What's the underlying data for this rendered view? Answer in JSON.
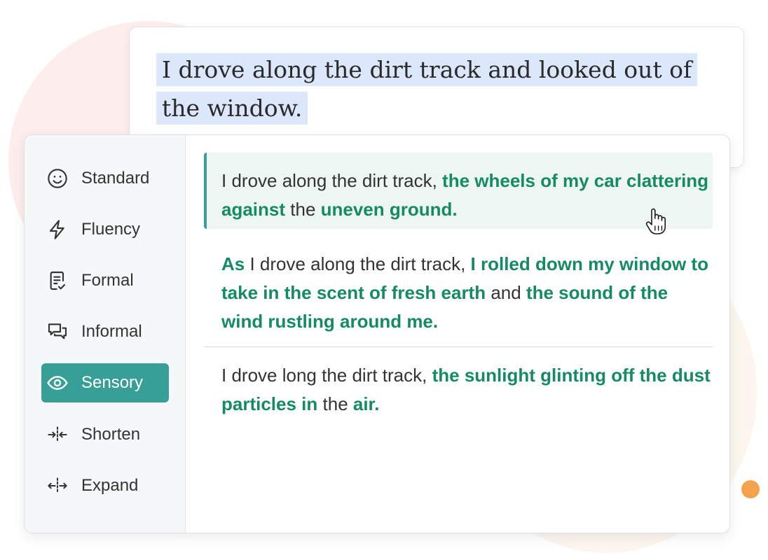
{
  "input": {
    "text": "I drove along the dirt track and looked out of the window."
  },
  "sidebar": {
    "items": [
      {
        "label": "Standard",
        "icon": "smiley-icon",
        "active": false
      },
      {
        "label": "Fluency",
        "icon": "lightning-icon",
        "active": false
      },
      {
        "label": "Formal",
        "icon": "document-check-icon",
        "active": false
      },
      {
        "label": "Informal",
        "icon": "chat-bubbles-icon",
        "active": false
      },
      {
        "label": "Sensory",
        "icon": "eye-icon",
        "active": true
      },
      {
        "label": "Shorten",
        "icon": "shorten-arrows-icon",
        "active": false
      },
      {
        "label": "Expand",
        "icon": "expand-arrows-icon",
        "active": false
      }
    ]
  },
  "suggestions": [
    {
      "selected": true,
      "parts": [
        {
          "t": "I drove along the dirt track, ",
          "hl": false
        },
        {
          "t": "the wheels of my car clattering against",
          "hl": true
        },
        {
          "t": " the ",
          "hl": false
        },
        {
          "t": "uneven ground.",
          "hl": true
        }
      ]
    },
    {
      "selected": false,
      "parts": [
        {
          "t": "As",
          "hl": true
        },
        {
          "t": " I drove along the dirt track, ",
          "hl": false
        },
        {
          "t": "I rolled down my window to take in the scent of fresh earth",
          "hl": true
        },
        {
          "t": " and ",
          "hl": false
        },
        {
          "t": "the sound of the wind rustling around me.",
          "hl": true
        }
      ]
    },
    {
      "selected": false,
      "parts": [
        {
          "t": "I drove long the dirt track, ",
          "hl": false
        },
        {
          "t": "the sunlight glinting off the dust particles in",
          "hl": true
        },
        {
          "t": " the ",
          "hl": false
        },
        {
          "t": "air.",
          "hl": true
        }
      ]
    }
  ],
  "colors": {
    "accent": "#379e98",
    "highlight_text": "#148b63",
    "selection_bg": "#dbe8fb",
    "orange_dot": "#f5a24f"
  }
}
